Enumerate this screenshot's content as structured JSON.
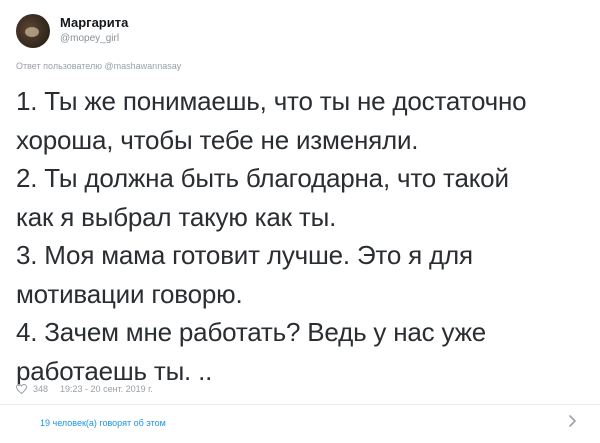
{
  "author": {
    "name": "Маргарита",
    "handle": "@mopey_girl"
  },
  "reply_to": {
    "prefix": "Ответ пользователю",
    "handle": "@mashawannasay"
  },
  "tweet": {
    "lines": [
      "1. Ты же понимаешь, что ты не достаточно",
      "хороша, чтобы тебе не изменяли.",
      "2. Ты должна быть благодарна, что такой",
      "как я выбрал такую как ты.",
      "3. Моя мама готовит лучше. Это я для",
      "мотивации говорю.",
      "4. Зачем мне работать? Ведь у нас уже",
      "работаешь ты. .."
    ]
  },
  "meta": {
    "likes": "348",
    "timestamp": "19:23 - 20 сент. 2019 г."
  },
  "footer": {
    "people_talking": "19 человек(а) говорят об этом"
  },
  "icons": {
    "like": "heart-icon",
    "more": "chevron-right-icon"
  },
  "colors": {
    "link": "#1b95e0",
    "muted": "#9aa1a8",
    "text": "#2a2e33"
  }
}
